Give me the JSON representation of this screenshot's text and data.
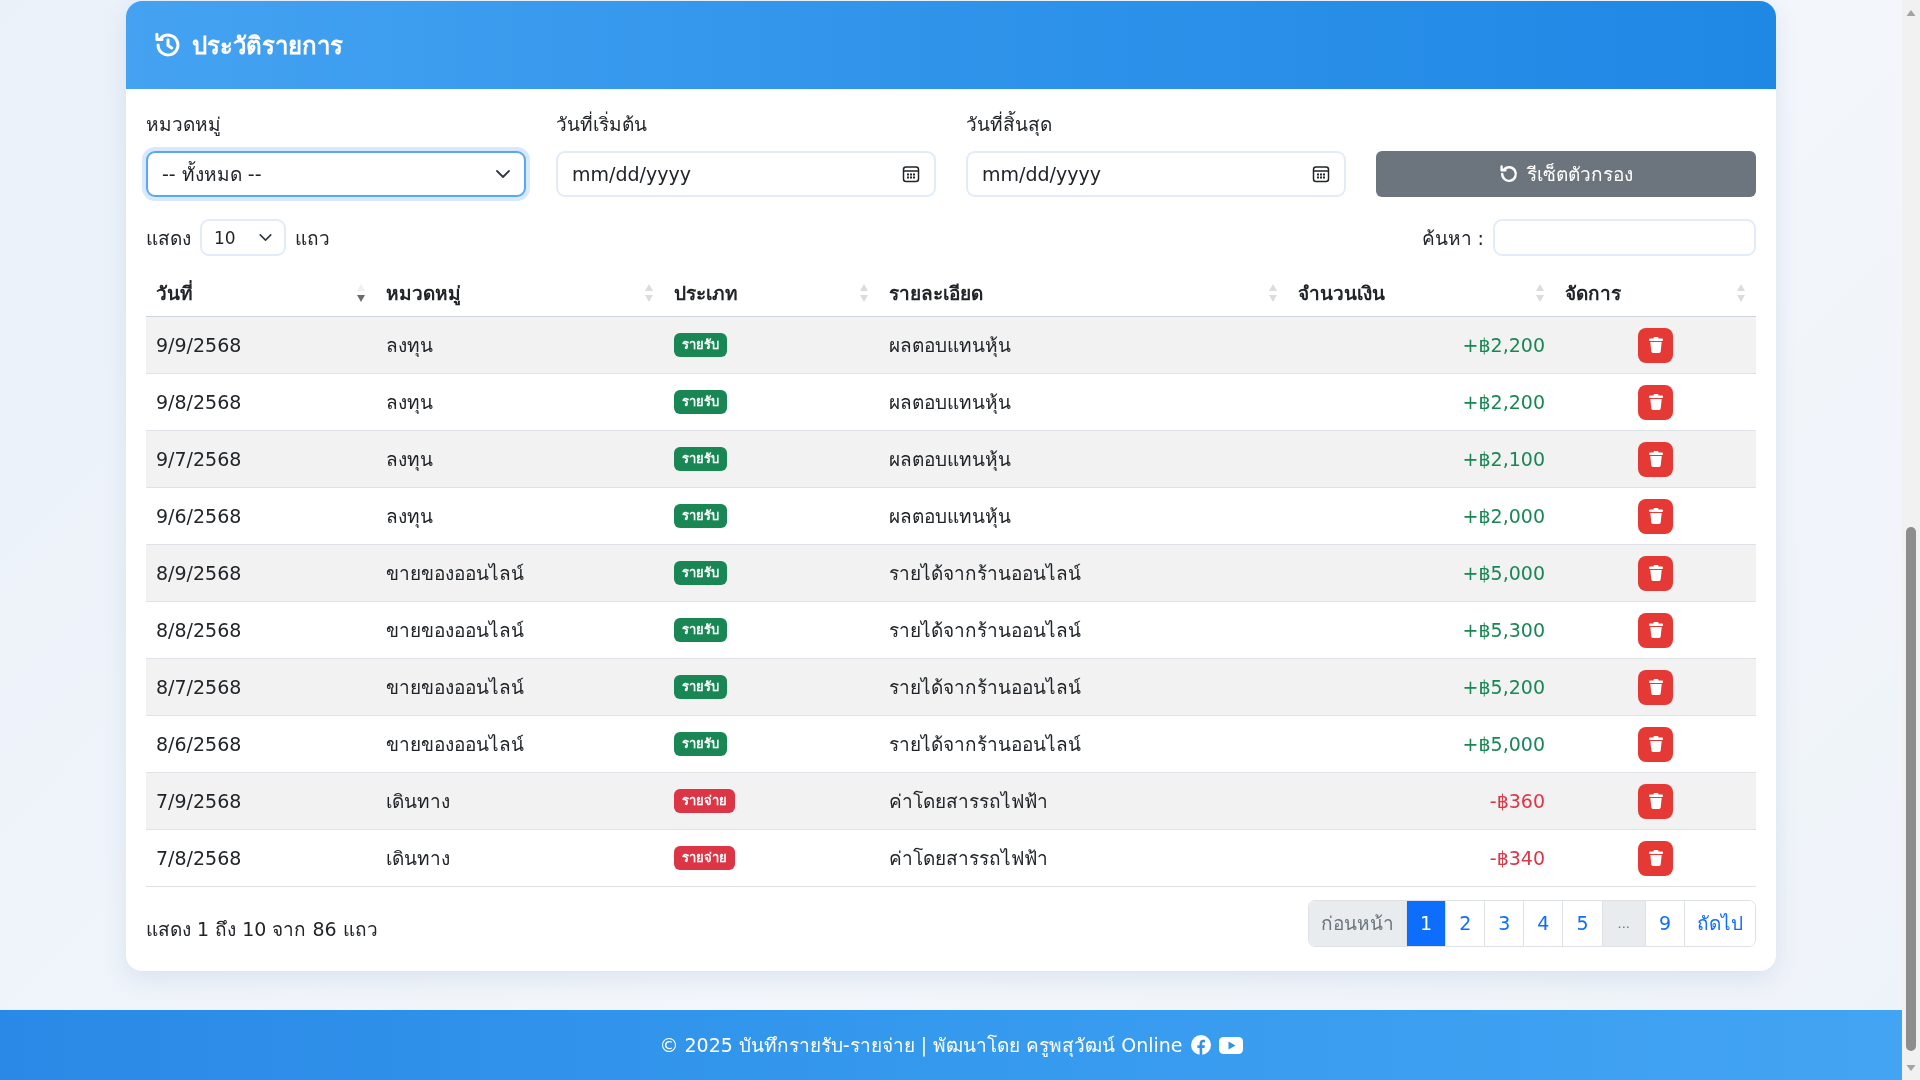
{
  "card": {
    "title": "ประวัติรายการ",
    "filters": [
      {
        "kind": "select",
        "label": "หมวดหมู่",
        "value": "-- ทั้งหมด --",
        "focused": true
      },
      {
        "kind": "date",
        "label": "วันที่เริ่มต้น",
        "placeholder": "mm/dd/yyyy",
        "focused": false
      },
      {
        "kind": "date",
        "label": "วันที่สิ้นสุด",
        "placeholder": "mm/dd/yyyy",
        "focused": false
      }
    ],
    "reset_button": "รีเซ็ตตัวกรอง",
    "length_menu": {
      "before": "แสดง",
      "value": "10",
      "after": "แถว"
    },
    "search": {
      "label": "ค้นหา :"
    },
    "table": {
      "columns": [
        {
          "label": "วันที่",
          "sorted": true
        },
        {
          "label": "หมวดหมู่",
          "sorted": false
        },
        {
          "label": "ประเภท",
          "sorted": false
        },
        {
          "label": "รายละเอียด",
          "sorted": false
        },
        {
          "label": "จำนวนเงิน",
          "sorted": false
        },
        {
          "label": "จัดการ",
          "sorted": false
        }
      ],
      "rows": [
        {
          "kind": "income",
          "date": "9/9/2568",
          "category": "ลงทุน",
          "type": "รายรับ",
          "details": "ผลตอบแทนหุ้น",
          "amount": "+฿2,200"
        },
        {
          "kind": "income",
          "date": "9/8/2568",
          "category": "ลงทุน",
          "type": "รายรับ",
          "details": "ผลตอบแทนหุ้น",
          "amount": "+฿2,200"
        },
        {
          "kind": "income",
          "date": "9/7/2568",
          "category": "ลงทุน",
          "type": "รายรับ",
          "details": "ผลตอบแทนหุ้น",
          "amount": "+฿2,100"
        },
        {
          "kind": "income",
          "date": "9/6/2568",
          "category": "ลงทุน",
          "type": "รายรับ",
          "details": "ผลตอบแทนหุ้น",
          "amount": "+฿2,000"
        },
        {
          "kind": "income",
          "date": "8/9/2568",
          "category": "ขายของออนไลน์",
          "type": "รายรับ",
          "details": "รายได้จากร้านออนไลน์",
          "amount": "+฿5,000"
        },
        {
          "kind": "income",
          "date": "8/8/2568",
          "category": "ขายของออนไลน์",
          "type": "รายรับ",
          "details": "รายได้จากร้านออนไลน์",
          "amount": "+฿5,300"
        },
        {
          "kind": "income",
          "date": "8/7/2568",
          "category": "ขายของออนไลน์",
          "type": "รายรับ",
          "details": "รายได้จากร้านออนไลน์",
          "amount": "+฿5,200"
        },
        {
          "kind": "income",
          "date": "8/6/2568",
          "category": "ขายของออนไลน์",
          "type": "รายรับ",
          "details": "รายได้จากร้านออนไลน์",
          "amount": "+฿5,000"
        },
        {
          "kind": "expense",
          "date": "7/9/2568",
          "category": "เดินทาง",
          "type": "รายจ่าย",
          "details": "ค่าโดยสารรถไฟฟ้า",
          "amount": "-฿360"
        },
        {
          "kind": "expense",
          "date": "7/8/2568",
          "category": "เดินทาง",
          "type": "รายจ่าย",
          "details": "ค่าโดยสารรถไฟฟ้า",
          "amount": "-฿340"
        }
      ]
    },
    "info": "แสดง 1 ถึง 10 จาก 86 แถว",
    "pagination": [
      {
        "kind": "prev",
        "label": "ก่อนหน้า",
        "selected": false,
        "disabled": true
      },
      {
        "kind": "page",
        "label": "1",
        "selected": true,
        "disabled": false
      },
      {
        "kind": "page",
        "label": "2",
        "selected": false,
        "disabled": false
      },
      {
        "kind": "page",
        "label": "3",
        "selected": false,
        "disabled": false
      },
      {
        "kind": "page",
        "label": "4",
        "selected": false,
        "disabled": false
      },
      {
        "kind": "page",
        "label": "5",
        "selected": false,
        "disabled": false
      },
      {
        "kind": "gap",
        "label": "...",
        "selected": false,
        "disabled": true
      },
      {
        "kind": "page",
        "label": "9",
        "selected": false,
        "disabled": false
      },
      {
        "kind": "next",
        "label": "ถัดไป",
        "selected": false,
        "disabled": false
      }
    ]
  },
  "footer": {
    "text": "© 2025 บันทึกรายรับ-รายจ่าย | พัฒนาโดย ครูพสุวัฒน์ Online",
    "links": [
      {
        "kind": "facebook"
      },
      {
        "kind": "youtube"
      }
    ]
  }
}
